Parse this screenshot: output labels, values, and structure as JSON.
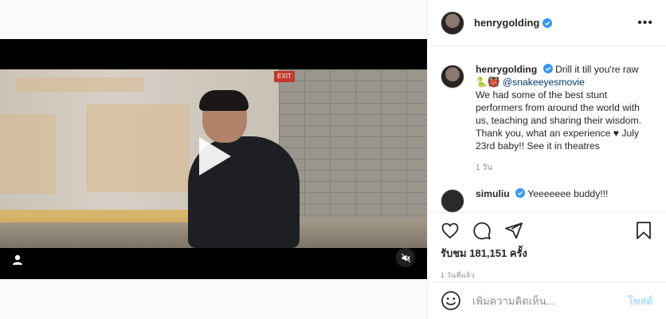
{
  "post": {
    "username": "henrygolding",
    "more_label": "•••",
    "caption": {
      "username": "henrygolding",
      "line1": "Drill it till you're raw",
      "emojis": "🐍👹",
      "mention": "@snakeeyesmovie",
      "text": "We had some of the best stunt performers from around the world with us, teaching and sharing their wisdom. Thank you, what an experience ♥ July 23rd baby!! See it in theatres",
      "time": "1 วัน"
    },
    "next_comment": {
      "username": "simuliu",
      "text": "Yeeeeeee buddy!!!"
    },
    "views_label": "รับชม 181,151 ครั้ง",
    "posted_time": "1 วันที่แล้ว",
    "comment_placeholder": "เพิ่มความคิดเห็น...",
    "post_button": "โพสต์"
  },
  "video": {
    "exit_sign": "EXIT"
  },
  "colors": {
    "verified": "#3897f0",
    "link": "#00376b",
    "post_disabled": "#b2dffc",
    "muted": "#8e8e8e"
  },
  "icons": [
    "play-icon",
    "user-tag-icon",
    "mute-icon",
    "verified-icon",
    "more-icon",
    "heart-icon",
    "comment-icon",
    "share-icon",
    "bookmark-icon",
    "smile-icon"
  ]
}
